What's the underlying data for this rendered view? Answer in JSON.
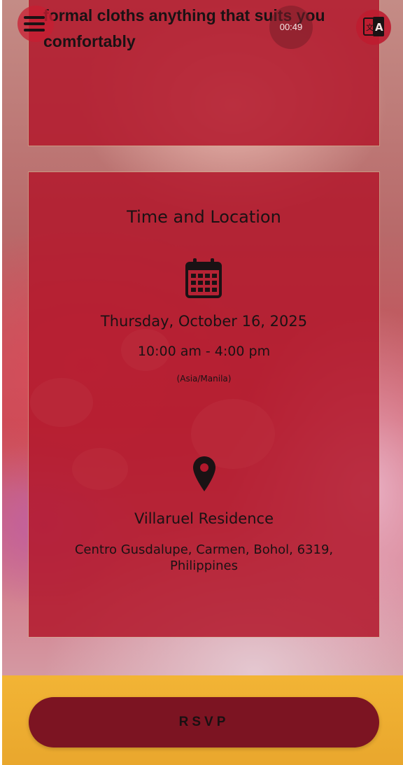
{
  "dress_code": {
    "text": "formal cloths anything that suits you comfortably"
  },
  "header": {
    "menu_icon": "hamburger-menu-icon",
    "timer": "00:49",
    "translate_icon": "translate-icon"
  },
  "time_location": {
    "title": "Time and Location",
    "calendar_icon": "calendar-icon",
    "date": "Thursday, October 16, 2025",
    "time": "10:00 am - 4:00 pm",
    "timezone": "(Asia/Manila)",
    "location_icon": "map-pin-icon",
    "venue_name": "Villaruel Residence",
    "venue_address": "Centro Gusdalupe, Carmen, Bohol, 6319, Philippines"
  },
  "footer": {
    "rsvp_label": "RSVP"
  },
  "colors": {
    "card": "#b2182c",
    "rsvp_button": "#7c1422",
    "bottom_bar": "#f2b435",
    "text": "#1a1214"
  }
}
